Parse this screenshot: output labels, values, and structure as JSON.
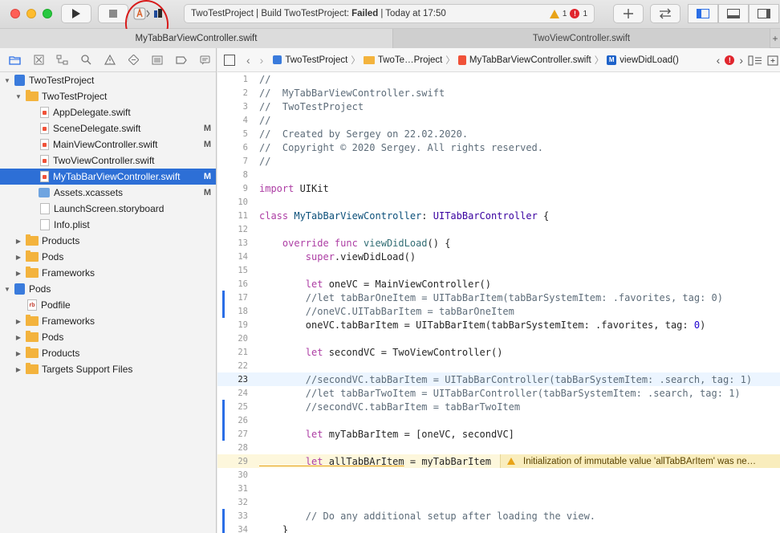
{
  "toolbar": {
    "status_prefix": "TwoTestProject | Build TwoTestProject:",
    "status_result": "Failed",
    "status_time": "| Today at 17:50",
    "warning_count": "1",
    "error_count": "1",
    "error_glyph": "!"
  },
  "tabs": [
    {
      "label": "MyTabBarViewController.swift"
    },
    {
      "label": "TwoViewController.swift"
    }
  ],
  "tab_add_glyph": "+",
  "navigator": {
    "items": [
      {
        "label": "TwoTestProject",
        "badge": ""
      },
      {
        "label": "TwoTestProject",
        "badge": ""
      },
      {
        "label": "AppDelegate.swift",
        "badge": ""
      },
      {
        "label": "SceneDelegate.swift",
        "badge": "M"
      },
      {
        "label": "MainViewController.swift",
        "badge": "M"
      },
      {
        "label": "TwoViewController.swift",
        "badge": ""
      },
      {
        "label": "MyTabBarViewController.swift",
        "badge": "M"
      },
      {
        "label": "Assets.xcassets",
        "badge": "M"
      },
      {
        "label": "LaunchScreen.storyboard",
        "badge": ""
      },
      {
        "label": "Info.plist",
        "badge": ""
      },
      {
        "label": "Products",
        "badge": ""
      },
      {
        "label": "Pods",
        "badge": ""
      },
      {
        "label": "Frameworks",
        "badge": ""
      },
      {
        "label": "Pods",
        "badge": ""
      },
      {
        "label": "Podfile",
        "badge": ""
      },
      {
        "label": "Frameworks",
        "badge": ""
      },
      {
        "label": "Pods",
        "badge": ""
      },
      {
        "label": "Products",
        "badge": ""
      },
      {
        "label": "Targets Support Files",
        "badge": ""
      }
    ]
  },
  "jumpbar": {
    "project": "TwoTestProject",
    "group": "TwoTe…Project",
    "file": "MyTabBarViewController.swift",
    "symbol_badge": "M",
    "symbol": "viewDidLoad()"
  },
  "code": {
    "line_numbers": [
      "1",
      "2",
      "3",
      "4",
      "5",
      "6",
      "7",
      "8",
      "9",
      "10",
      "11",
      "12",
      "13",
      "14",
      "15",
      "16",
      "17",
      "18",
      "19",
      "20",
      "21",
      "22",
      "23",
      "24",
      "25",
      "26",
      "27",
      "28",
      "29",
      "30",
      "31",
      "32",
      "33",
      "34"
    ],
    "l1": "//",
    "l2": "//  MyTabBarViewController.swift",
    "l3": "//  TwoTestProject",
    "l4": "//",
    "l5": "//  Created by Sergey on 22.02.2020.",
    "l6": "//  Copyright © 2020 Sergey. All rights reserved.",
    "l7": "//",
    "l9_kw": "import",
    "l9_rest": " UIKit",
    "l11_kw": "class",
    "l11_name": " MyTabBarViewController",
    "l11_colon": ": ",
    "l11_super": "UITabBarController",
    "l11_brace": " {",
    "l13_kw1": "    override",
    "l13_kw2": " func",
    "l13_fn": " viewDidLoad",
    "l13_rest": "() {",
    "l14_kw": "        super",
    "l14_rest": ".viewDidLoad()",
    "l16_kw": "        let",
    "l16_rest": " oneVC = MainViewController()",
    "l17": "        //let tabBarOneItem = UITabBarItem(tabBarSystemItem: .favorites, tag: 0)",
    "l18": "        //oneVC.UITabBarItem = tabBarOneItem",
    "l19_a": "        oneVC.tabBarItem = UITabBarItem(tabBarSystemItem: .favorites, tag: ",
    "l19_num": "0",
    "l19_b": ")",
    "l21_kw": "        let",
    "l21_rest": " secondVC = TwoViewController()",
    "l23": "        //secondVC.tabBarItem = UITabBarController(tabBarSystemItem: .search, tag: 1)",
    "l24": "        //let tabBarTwoItem = UITabBarController(tabBarSystemItem: .search, tag: 1)",
    "l25": "        //secondVC.tabBarItem = tabBarTwoItem",
    "l27_kw": "        let",
    "l27_rest": " myTabBarItem = [oneVC, secondVC]",
    "l29_kw": "        let",
    "l29_var": " allTabBArItem",
    "l29_rest": " = myTabBarItem",
    "l33": "        // Do any additional setup after loading the view.",
    "l34": "    }"
  },
  "warning_message": "Initialization of immutable value 'allTabBArItem' was ne…",
  "colors": {
    "selection": "#2d6fd6",
    "error": "#e0262e",
    "warning": "#e8a317",
    "annotation_circle": "#d81b1b"
  }
}
